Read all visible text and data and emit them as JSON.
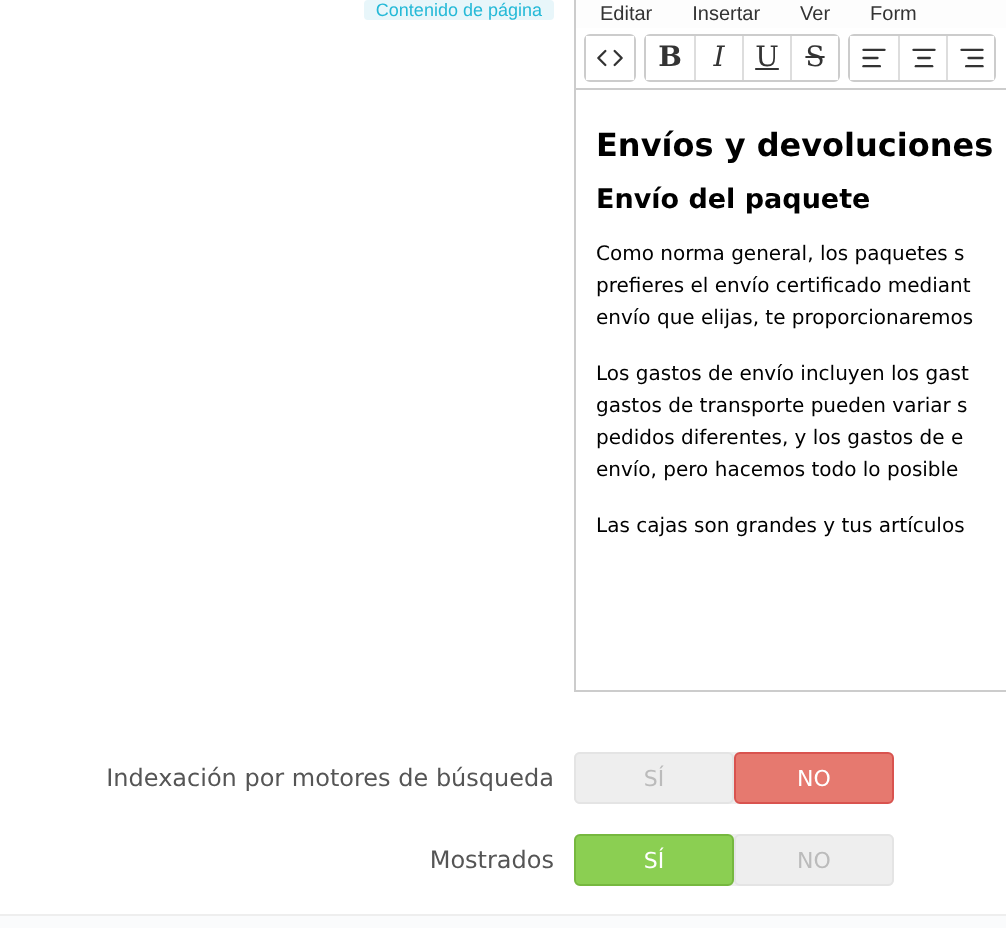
{
  "field_label": "Contenido de página",
  "editor": {
    "menu": [
      "Editar",
      "Insertar",
      "Ver",
      "Form"
    ],
    "toolbar": [
      [
        {
          "kind": "code"
        }
      ],
      [
        {
          "kind": "bold",
          "label": "B"
        },
        {
          "kind": "italic",
          "label": "I"
        },
        {
          "kind": "underline",
          "label": "U"
        },
        {
          "kind": "strike",
          "label": "S"
        }
      ],
      [
        {
          "kind": "align-left"
        },
        {
          "kind": "align-center"
        },
        {
          "kind": "align-right"
        }
      ]
    ],
    "content": [
      {
        "kind": "h1",
        "text": "Envíos y devoluciones"
      },
      {
        "kind": "h2",
        "text": "Envío del paquete"
      },
      {
        "kind": "p",
        "lines": [
          "Como norma general, los paquetes s",
          "prefieres el envío certificado mediant",
          "envío que elijas, te proporcionaremos"
        ]
      },
      {
        "kind": "p",
        "lines": [
          "Los gastos de envío incluyen los gast",
          "gastos de transporte pueden variar s",
          "pedidos diferentes, y los gastos de e",
          "envío, pero hacemos todo lo posible"
        ]
      },
      {
        "kind": "p",
        "lines": [
          "Las cajas son grandes y tus artículos"
        ]
      }
    ]
  },
  "settings": [
    {
      "label": "Indexación por motores de búsqueda",
      "options": [
        {
          "label": "SÍ",
          "selected": false
        },
        {
          "label": "NO",
          "selected": true
        }
      ]
    },
    {
      "label": "Mostrados",
      "options": [
        {
          "label": "SÍ",
          "selected": true
        },
        {
          "label": "NO",
          "selected": false
        }
      ]
    }
  ]
}
